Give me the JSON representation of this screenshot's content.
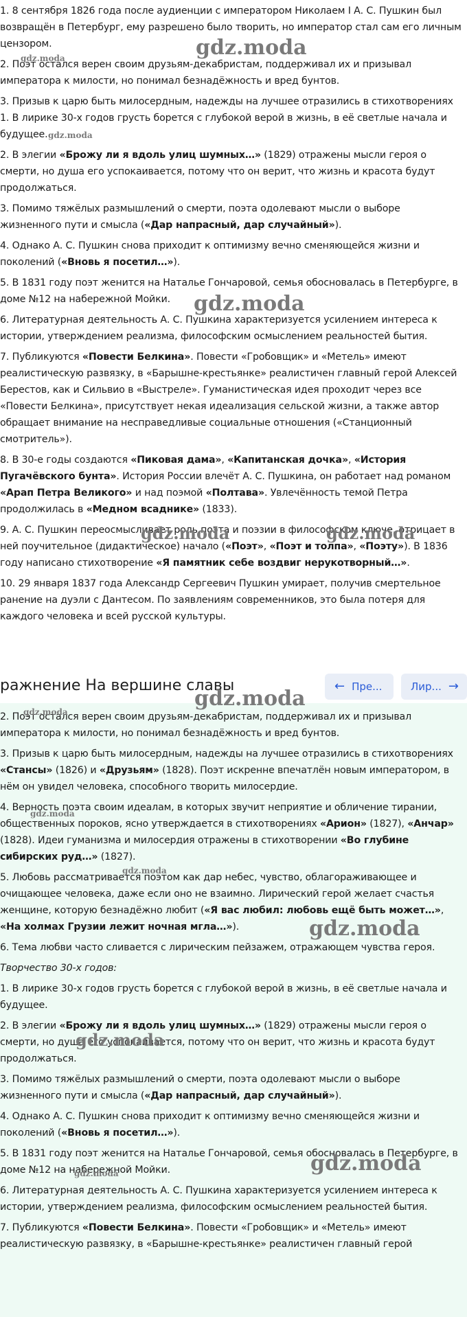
{
  "top_paragraphs": [
    [
      {
        "t": "1. 8 сентября 1826 года после аудиенции с императором Николаем I А. С. Пушкин был возвращён в Петербург, ему разрешено было творить, но император стал сам его личным цензором."
      }
    ],
    [
      {
        "t": "2. Поэт остался верен своим друзьям-декабристам, поддерживал их и призывал императора к милости, но понимал безнадёжность и вред бунтов."
      }
    ],
    [
      {
        "t": "3. Призыв к царю быть милосердным, надежды на лучшее отразились в стихотворениях 1. В лирике 30-х годов грусть борется с глубокой верой в жизнь, в её светлые начала и будущее."
      }
    ],
    [
      {
        "t": "2. В элегии "
      },
      {
        "t": "«Брожу ли я вдоль улиц шумных…»",
        "b": true
      },
      {
        "t": " (1829) отражены мысли героя о смерти, но душа его успокаивается, потому что он верит, что жизнь и красота будут продолжаться."
      }
    ],
    [
      {
        "t": "3. Помимо тяжёлых размышлений о смерти, поэта одолевают мысли о выборе жизненного пути и смысла ("
      },
      {
        "t": "«Дар напрасный, дар случайный»",
        "b": true
      },
      {
        "t": ")."
      }
    ],
    [
      {
        "t": "4. Однако А. С. Пушкин снова приходит к оптимизму вечно сменяющейся жизни и поколений ("
      },
      {
        "t": "«Вновь я посетил…»",
        "b": true
      },
      {
        "t": ")."
      }
    ],
    [
      {
        "t": "5. В 1831 году поэт женится на Наталье Гончаровой, семья обосновалась в Петербурге, в доме №12 на набережной Мойки."
      }
    ],
    [
      {
        "t": "6. Литературная деятельность А. С. Пушкина характеризуется усилением интереса к истории, утверждением реализма, философским осмыслением реальностей бытия."
      }
    ],
    [
      {
        "t": "7. Публикуются "
      },
      {
        "t": "«Повести Белкина»",
        "b": true
      },
      {
        "t": ". Повести «Гробовщик» и «Метель» имеют реалистическую развязку, в «Барышне-крестьянке» реалистичен главный герой Алексей Берестов, как и Сильвио в «Выстреле». Гуманистическая идея проходит через все «Повести Белкина», присутствует некая идеализация сельской жизни, а также автор обращает внимание на несправедливые социальные отношения («Станционный смотритель»)."
      }
    ],
    [
      {
        "t": "8. В 30-е годы создаются "
      },
      {
        "t": "«Пиковая дама»",
        "b": true
      },
      {
        "t": ", "
      },
      {
        "t": "«Капитанская дочка»",
        "b": true
      },
      {
        "t": ", "
      },
      {
        "t": "«История Пугачёвского бунта»",
        "b": true
      },
      {
        "t": ". История России влечёт А. С. Пушкина, он работает над романом "
      },
      {
        "t": "«Арап Петра Великого»",
        "b": true
      },
      {
        "t": " и над поэмой "
      },
      {
        "t": "«Полтава»",
        "b": true
      },
      {
        "t": ". Увлечённость темой Петра продолжилась в "
      },
      {
        "t": "«Медном всаднике»",
        "b": true
      },
      {
        "t": " (1833)."
      }
    ],
    [
      {
        "t": "9. А. С. Пушкин переосмысливает роль поэта и поэзии в философском ключе, отрицает в ней поучительное (дидактическое) начало ("
      },
      {
        "t": "«Поэт»",
        "b": true
      },
      {
        "t": ", "
      },
      {
        "t": "«Поэт и толпа»",
        "b": true
      },
      {
        "t": ", "
      },
      {
        "t": "«Поэту»",
        "b": true
      },
      {
        "t": "). В 1836 году написано стихотворение "
      },
      {
        "t": "«Я памятник себе воздвиг нерукотворный…»",
        "b": true
      },
      {
        "t": "."
      }
    ],
    [
      {
        "t": "10. 29 января 1837 года Александр Сергеевич Пушкин умирает, получив смертельное ранение на дуэли с Дантесом. По заявлениям современников, это была потеря для каждого человека и всей русской культуры."
      }
    ]
  ],
  "header": {
    "title": "ражнение На вершине славы",
    "prev_label": "Пре...",
    "next_label": "Лир..."
  },
  "green_paragraphs": [
    [
      {
        "t": "2. Поэт остался верен своим друзьям-декабристам, поддерживал их и призывал императора к милости, но понимал безнадёжность и вред бунтов."
      }
    ],
    [
      {
        "t": "3. Призыв к царю быть милосердным, надежды на лучшее отразились в стихотворениях "
      },
      {
        "t": "«Стансы»",
        "b": true
      },
      {
        "t": " (1826) и "
      },
      {
        "t": "«Друзьям»",
        "b": true
      },
      {
        "t": " (1828). Поэт искренне впечатлён новым императором, в нём он увидел человека, способного творить милосердие."
      }
    ],
    [
      {
        "t": "4. Верность поэта своим идеалам, в которых звучит неприятие и обличение тирании, общественных пороков, ясно утверждается в стихотворениях "
      },
      {
        "t": "«Арион»",
        "b": true
      },
      {
        "t": " (1827), "
      },
      {
        "t": "«Анчар»",
        "b": true
      },
      {
        "t": " (1828). Идеи гуманизма и милосердия отражены в стихотворении "
      },
      {
        "t": "«Во глубине сибирских руд…»",
        "b": true
      },
      {
        "t": " (1827)."
      }
    ],
    [
      {
        "t": "5. Любовь рассматривается поэтом как дар небес, чувство, облагораживающее и очищающее человека, даже если оно не взаимно. Лирический герой желает счастья женщине, которую безнадёжно любит ("
      },
      {
        "t": "«Я вас любил: любовь ещё быть может…»",
        "b": true
      },
      {
        "t": ", "
      },
      {
        "t": "«На холмах Грузии лежит ночная мгла…»",
        "b": true
      },
      {
        "t": ")."
      }
    ],
    [
      {
        "t": "6. Тема любви часто сливается с лирическим пейзажем, отражающем чувства героя."
      }
    ],
    [
      {
        "t": "Творчество 30-х годов:",
        "i": true
      }
    ],
    [
      {
        "t": "1. В лирике 30-х годов грусть борется с глубокой верой в жизнь, в её светлые начала и будущее."
      }
    ],
    [
      {
        "t": "2. В элегии "
      },
      {
        "t": "«Брожу ли я вдоль улиц шумных…»",
        "b": true
      },
      {
        "t": " (1829) отражены мысли героя о смерти, но душа его успокаивается, потому что он верит, что жизнь и красота будут продолжаться."
      }
    ],
    [
      {
        "t": "3. Помимо тяжёлых размышлений о смерти, поэта одолевают мысли о выборе жизненного пути и смысла ("
      },
      {
        "t": "«Дар напрасный, дар случайный»",
        "b": true
      },
      {
        "t": ")."
      }
    ],
    [
      {
        "t": "4. Однако А. С. Пушкин снова приходит к оптимизму вечно сменяющейся жизни и поколений ("
      },
      {
        "t": "«Вновь я посетил…»",
        "b": true
      },
      {
        "t": ")."
      }
    ],
    [
      {
        "t": "5. В 1831 году поэт женится на Наталье Гончаровой, семья обосновалась в Петербурге, в доме №12 на набережной Мойки."
      }
    ],
    [
      {
        "t": "6. Литературная деятельность А. С. Пушкина характеризуется усилением интереса к истории, утверждением реализма, философским осмыслением реальностей бытия."
      }
    ],
    [
      {
        "t": "7. Публикуются "
      },
      {
        "t": "«Повести Белкина»",
        "b": true
      },
      {
        "t": ". Повести «Гробовщик» и «Метель» имеют реалистическую развязку, в «Барышне-крестьянке» реалистичен главный герой"
      }
    ]
  ],
  "watermark_text": "gdz.moda",
  "colors": {
    "green_background": "#eefaf4",
    "nav_button_bg": "#e9eef7",
    "nav_button_text": "#2a5bd7",
    "watermark": "#7a7a7a"
  }
}
